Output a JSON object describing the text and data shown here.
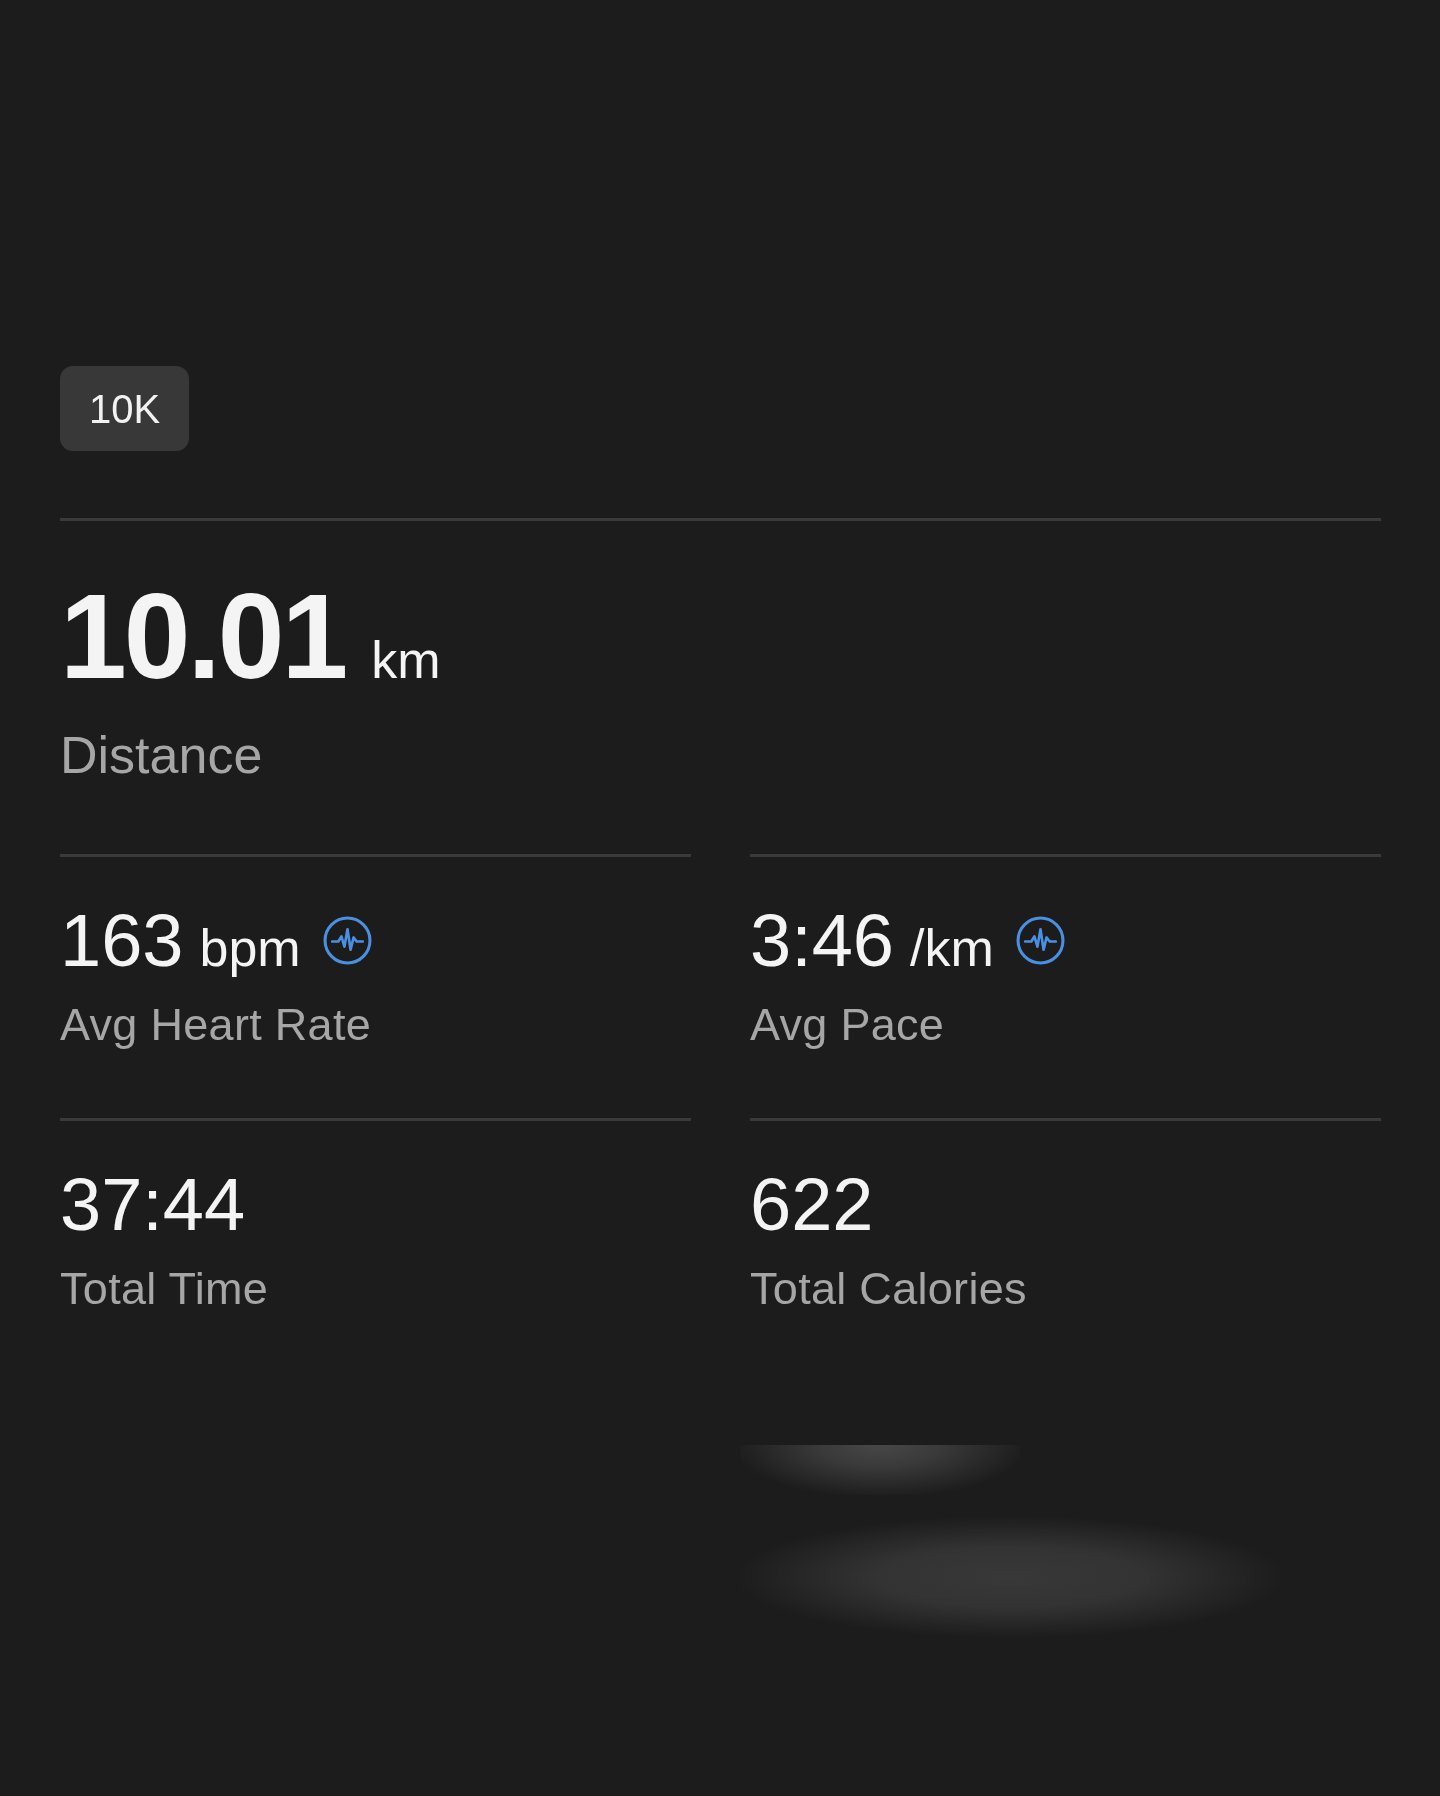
{
  "badge": {
    "label": "10K"
  },
  "primary_stat": {
    "value": "10.01",
    "unit": "km",
    "label": "Distance"
  },
  "stats": [
    {
      "value": "163",
      "unit": "bpm",
      "label": "Avg Heart Rate",
      "has_icon": true
    },
    {
      "value": "3:46",
      "unit": "/km",
      "label": "Avg Pace",
      "has_icon": true
    },
    {
      "value": "37:44",
      "label": "Total Time",
      "has_icon": false
    },
    {
      "value": "622",
      "label": "Total Calories",
      "has_icon": false
    }
  ]
}
